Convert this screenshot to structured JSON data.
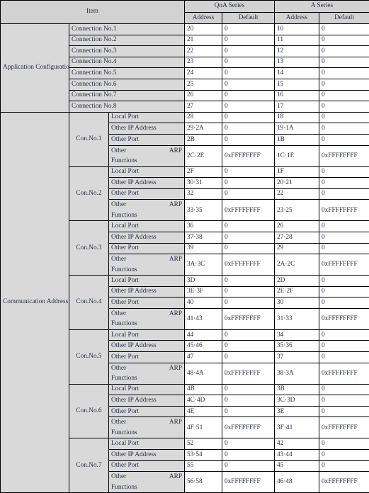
{
  "table": {
    "headers": {
      "item": "Item",
      "qna_series": "QnA Series",
      "a_series": "A Series",
      "address": "Address",
      "default": "Default"
    },
    "colors": {
      "header_bg": "#d2d2d2",
      "label_bg": "#d9d9d9",
      "value_bg": "#ffffff",
      "text": "#2b3044",
      "border": "#000000"
    },
    "sections": [
      {
        "area": "Application Configuration Area",
        "rows": [
          {
            "label": "Connection No.1",
            "qna_address": "20",
            "qna_default": "0",
            "a_address": "10",
            "a_default": "0"
          },
          {
            "label": "Connection No.2",
            "qna_address": "21",
            "qna_default": "0",
            "a_address": "11",
            "a_default": "0"
          },
          {
            "label": "Connection No.3",
            "qna_address": "22",
            "qna_default": "0",
            "a_address": "12",
            "a_default": "0"
          },
          {
            "label": "Connection No.4",
            "qna_address": "23",
            "qna_default": "0",
            "a_address": "13",
            "a_default": "0"
          },
          {
            "label": "Connection No.5",
            "qna_address": "24",
            "qna_default": "0",
            "a_address": "14",
            "a_default": "0"
          },
          {
            "label": "Connection No.6",
            "qna_address": "25",
            "qna_default": "0",
            "a_address": "15",
            "a_default": "0"
          },
          {
            "label": "Connection No.7",
            "qna_address": "26",
            "qna_default": "0",
            "a_address": "16",
            "a_default": "0"
          },
          {
            "label": "Connection No.8",
            "qna_address": "27",
            "qna_default": "0",
            "a_address": "17",
            "a_default": "0"
          }
        ]
      },
      {
        "area": "Communication Address Configuration Area",
        "connections": [
          {
            "name": "Con.No.1",
            "rows": [
              {
                "label": "Local Port",
                "qna_address": "28",
                "qna_default": "0",
                "a_address": "18",
                "a_default": "0"
              },
              {
                "label": "Other IP Address",
                "qna_address": "29·2A",
                "qna_default": "0",
                "a_address": "19·1A",
                "a_default": "0"
              },
              {
                "label": "Other Port",
                "qna_address": "2B",
                "qna_default": "0",
                "a_address": "1B",
                "a_default": "0"
              },
              {
                "label_a": "Other",
                "label_b": "ARP",
                "label_c": "Functions",
                "qna_address": "2C·2E",
                "qna_default": "0xFFFFFFFF",
                "a_address": "1C·1E",
                "a_default": "0xFFFFFFFF"
              }
            ]
          },
          {
            "name": "Con.No.2",
            "rows": [
              {
                "label": "Local Port",
                "qna_address": "2F",
                "qna_default": "0",
                "a_address": "1F",
                "a_default": "0"
              },
              {
                "label": "Other IP Address",
                "qna_address": "30·31",
                "qna_default": "0",
                "a_address": "20·21",
                "a_default": "0"
              },
              {
                "label": "Other Port",
                "qna_address": "32",
                "qna_default": "0",
                "a_address": "22",
                "a_default": "0"
              },
              {
                "label_a": "Other",
                "label_b": "ARP",
                "label_c": "Functions",
                "qna_address": "33·35",
                "qna_default": "0xFFFFFFFF",
                "a_address": "23·25",
                "a_default": "0xFFFFFFFF"
              }
            ]
          },
          {
            "name": "Con.No.3",
            "rows": [
              {
                "label": "Local Port",
                "qna_address": "36",
                "qna_default": "0",
                "a_address": "26",
                "a_default": "0"
              },
              {
                "label": "Other IP Address",
                "qna_address": "37·38",
                "qna_default": "0",
                "a_address": "27·28",
                "a_default": "0"
              },
              {
                "label": "Other Port",
                "qna_address": "39",
                "qna_default": "0",
                "a_address": "29",
                "a_default": "0"
              },
              {
                "label_a": "Other",
                "label_b": "ARP",
                "label_c": "Functions",
                "qna_address": "3A·3C",
                "qna_default": "0xFFFFFFFF",
                "a_address": "2A·2C",
                "a_default": "0xFFFFFFFF"
              }
            ]
          },
          {
            "name": "Con.No.4",
            "rows": [
              {
                "label": "Local Port",
                "qna_address": "3D",
                "qna_default": "0",
                "a_address": "2D",
                "a_default": "0"
              },
              {
                "label": "Other IP Address",
                "qna_address": "3E·3F",
                "qna_default": "0",
                "a_address": "2E·2F",
                "a_default": "0"
              },
              {
                "label": "Other Port",
                "qna_address": "40",
                "qna_default": "0",
                "a_address": "30",
                "a_default": "0"
              },
              {
                "label_a": "Other",
                "label_b": "ARP",
                "label_c": "Functions",
                "qna_address": "41·43",
                "qna_default": "0xFFFFFFFF",
                "a_address": "31·33",
                "a_default": "0xFFFFFFFF"
              }
            ]
          },
          {
            "name": "Con.No.5",
            "rows": [
              {
                "label": "Local Port",
                "qna_address": "44",
                "qna_default": "0",
                "a_address": "34",
                "a_default": "0"
              },
              {
                "label": "Other IP Address",
                "qna_address": "45·46",
                "qna_default": "0",
                "a_address": "35·36",
                "a_default": "0"
              },
              {
                "label": "Other Port",
                "qna_address": "47",
                "qna_default": "0",
                "a_address": "37",
                "a_default": "0"
              },
              {
                "label_a": "Other",
                "label_b": "ARP",
                "label_c": "Functions",
                "qna_address": "48·4A",
                "qna_default": "0xFFFFFFFF",
                "a_address": "38·3A",
                "a_default": "0xFFFFFFFF"
              }
            ]
          },
          {
            "name": "Con.No.6",
            "rows": [
              {
                "label": "Local Port",
                "qna_address": "4B",
                "qna_default": "0",
                "a_address": "3B",
                "a_default": "0"
              },
              {
                "label": "Other IP Address",
                "qna_address": "4C·4D",
                "qna_default": "0",
                "a_address": "3C·3D",
                "a_default": "0"
              },
              {
                "label": "Other Port",
                "qna_address": "4E",
                "qna_default": "0",
                "a_address": "3E",
                "a_default": "0"
              },
              {
                "label_a": "Other",
                "label_b": "ARP",
                "label_c": "Functions",
                "qna_address": "4F·51",
                "qna_default": "0xFFFFFFFF",
                "a_address": "3F·41",
                "a_default": "0xFFFFFFFF"
              }
            ]
          },
          {
            "name": "Con.No.7",
            "rows": [
              {
                "label": "Local Port",
                "qna_address": "52",
                "qna_default": "0",
                "a_address": "42",
                "a_default": "0"
              },
              {
                "label": "Other IP Address",
                "qna_address": "53·54",
                "qna_default": "0",
                "a_address": "43·44",
                "a_default": "0"
              },
              {
                "label": "Other Port",
                "qna_address": "55",
                "qna_default": "0",
                "a_address": "45",
                "a_default": "0"
              },
              {
                "label_a": "Other",
                "label_b": "ARP",
                "label_c": "Functions",
                "qna_address": "56·58",
                "qna_default": "0xFFFFFFFF",
                "a_address": "46·48",
                "a_default": "0xFFFFFFFF"
              }
            ]
          }
        ]
      }
    ]
  }
}
